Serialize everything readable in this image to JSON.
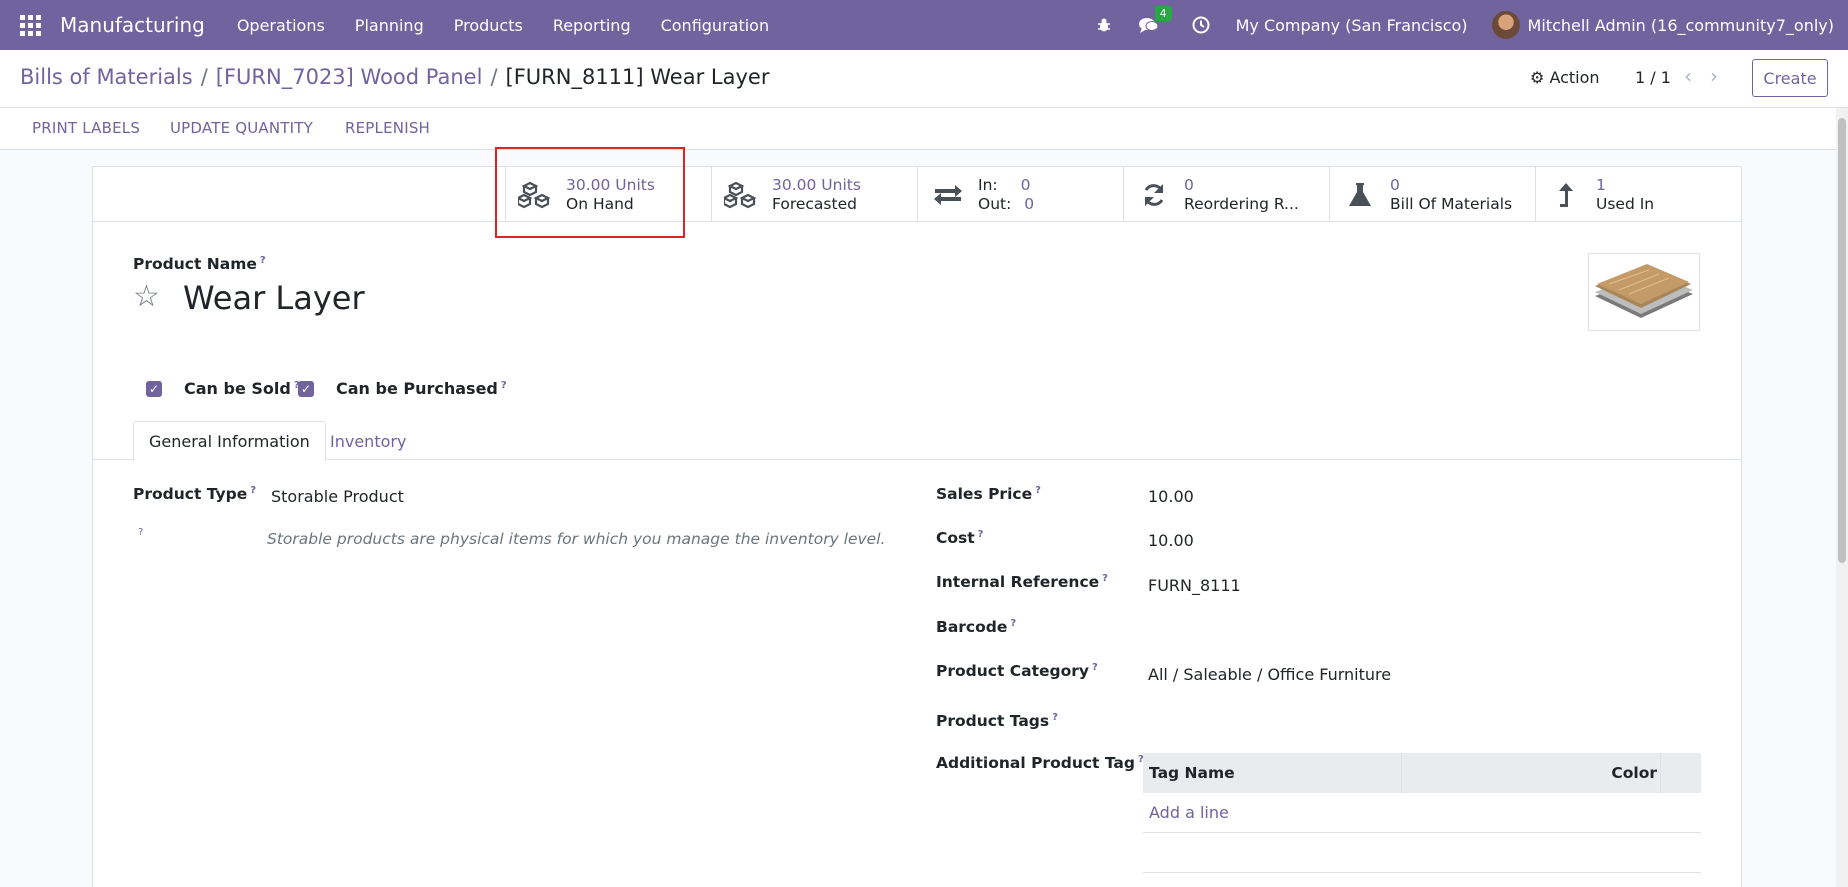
{
  "navbar": {
    "brand": "Manufacturing",
    "menu": [
      "Operations",
      "Planning",
      "Products",
      "Reporting",
      "Configuration"
    ],
    "messages_badge": "4",
    "company": "My Company (San Francisco)",
    "user": "Mitchell Admin (16_community7_only)"
  },
  "breadcrumb": {
    "items": [
      "Bills of Materials",
      "[FURN_7023] Wood Panel",
      "[FURN_8111] Wear Layer"
    ],
    "separator": "/"
  },
  "control": {
    "action_label": "Action",
    "pager": "1 / 1",
    "create_label": "Create"
  },
  "header_buttons": [
    "PRINT LABELS",
    "UPDATE QUANTITY",
    "REPLENISH"
  ],
  "stat_buttons": {
    "on_hand": {
      "value": "30.00 Units",
      "label": "On Hand"
    },
    "forecasted": {
      "value": "30.00 Units",
      "label": "Forecasted"
    },
    "in_out": {
      "in_label": "In:",
      "in_value": "0",
      "out_label": "Out:",
      "out_value": "0"
    },
    "reordering": {
      "value": "0",
      "label": "Reordering R..."
    },
    "bom": {
      "value": "0",
      "label": "Bill Of Materials"
    },
    "used_in": {
      "value": "1",
      "label": "Used In"
    }
  },
  "product": {
    "name_label": "Product Name",
    "name": "Wear Layer",
    "can_be_sold_label": "Can be Sold",
    "can_be_purchased_label": "Can be Purchased"
  },
  "tabs": [
    "General Information",
    "Inventory"
  ],
  "general": {
    "product_type_label": "Product Type",
    "product_type_value": "Storable Product",
    "product_type_hint": "Storable products are physical items for which you manage the inventory level.",
    "sales_price_label": "Sales Price",
    "sales_price_value": "10.00",
    "cost_label": "Cost",
    "cost_value": "10.00",
    "internal_ref_label": "Internal Reference",
    "internal_ref_value": "FURN_8111",
    "barcode_label": "Barcode",
    "category_label": "Product Category",
    "category_value": "All / Saleable / Office Furniture",
    "tags_label": "Product Tags",
    "additional_tag_label": "Additional Product Tag",
    "tag_table": {
      "col_name": "Tag Name",
      "col_color": "Color",
      "add_line": "Add a line"
    }
  },
  "help_mark": "?"
}
